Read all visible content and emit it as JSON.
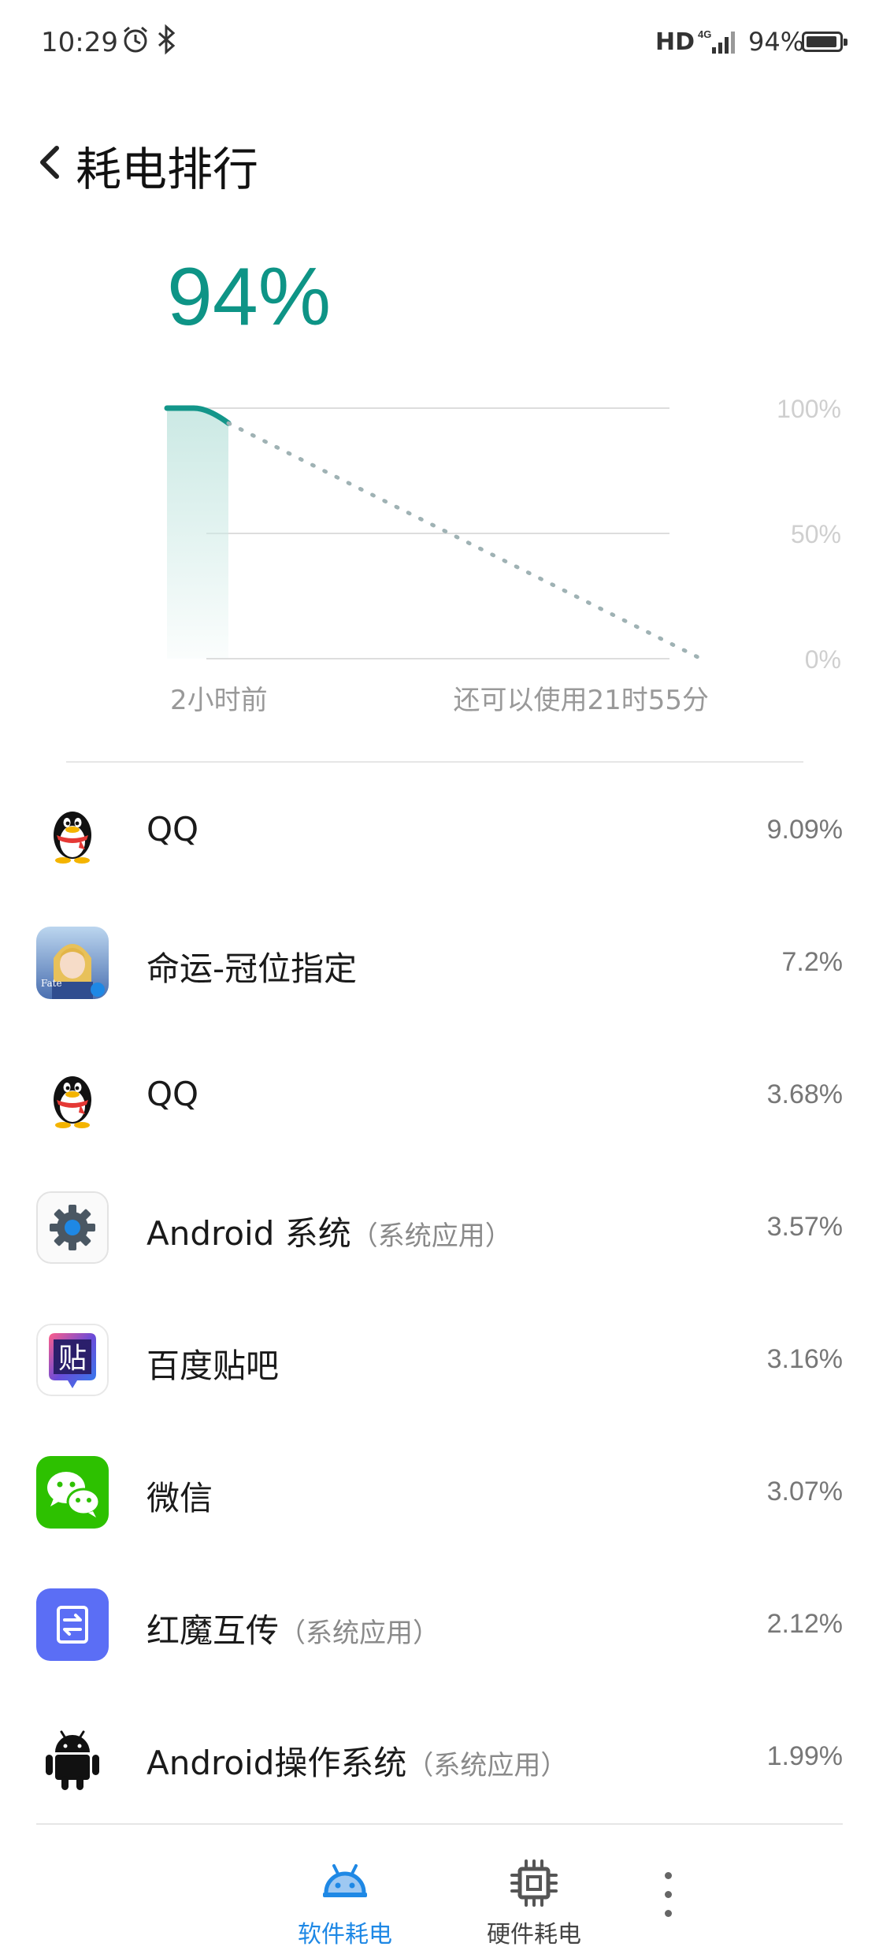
{
  "status_bar": {
    "time": "10:29",
    "network": "HD",
    "signal": "4G",
    "battery_text": "94%",
    "battery_level": 0.94,
    "icons": [
      "alarm-icon",
      "bluetooth-icon",
      "signal-icon",
      "battery-icon"
    ]
  },
  "header": {
    "title": "耗电排行",
    "back_icon": "chevron-left-icon"
  },
  "battery": {
    "percent_text": "94%"
  },
  "chart_data": {
    "type": "area",
    "y_tick_labels": [
      "100%",
      "50%",
      "0%"
    ],
    "ylim": [
      0,
      100
    ],
    "x_start_label": "2小时前",
    "x_end_label": "还可以使用21时55分",
    "history": [
      100,
      100,
      94
    ],
    "projection": [
      94,
      0
    ],
    "colors": {
      "history": "#13968a",
      "fill": "#cbe9e4",
      "projection": "#9fb2b4",
      "grid": "#dddddd"
    }
  },
  "apps": [
    {
      "name": "QQ",
      "tag": "",
      "percent": "9.09%",
      "icon": "qq-icon"
    },
    {
      "name": "命运-冠位指定",
      "tag": "",
      "percent": "7.2%",
      "icon": "fgo-game-icon"
    },
    {
      "name": "QQ",
      "tag": "",
      "percent": "3.68%",
      "icon": "qq-icon"
    },
    {
      "name": "Android 系统",
      "tag": "（系统应用）",
      "percent": "3.57%",
      "icon": "gear-icon"
    },
    {
      "name": "百度贴吧",
      "tag": "",
      "percent": "3.16%",
      "icon": "tieba-icon"
    },
    {
      "name": "微信",
      "tag": "",
      "percent": "3.07%",
      "icon": "wechat-icon"
    },
    {
      "name": "红魔互传",
      "tag": "（系统应用）",
      "percent": "2.12%",
      "icon": "transfer-icon"
    },
    {
      "name": "Android操作系统",
      "tag": "（系统应用）",
      "percent": "1.99%",
      "icon": "android-icon"
    }
  ],
  "bottom_nav": {
    "software_label": "软件耗电",
    "hardware_label": "硬件耗电",
    "active": "software",
    "colors": {
      "active": "#1e88e5",
      "inactive": "#444444"
    }
  }
}
